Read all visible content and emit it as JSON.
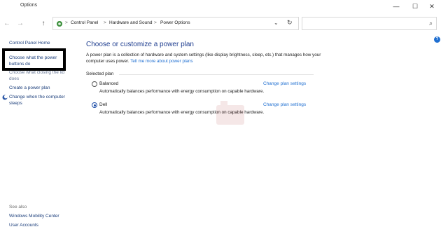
{
  "window": {
    "title": "Options"
  },
  "titlebar": {
    "minimize": "—",
    "maximize": "☐",
    "close": "✕"
  },
  "nav": {
    "back": "←",
    "forward": "→",
    "up": "↑",
    "breadcrumbs": [
      "Control Panel",
      "Hardware and Sound",
      "Power Options"
    ],
    "separator": ">",
    "chevron": "⌄",
    "refresh": "↻",
    "search_icon": "⌕",
    "search_placeholder": ""
  },
  "help": {
    "label": "?"
  },
  "sidebar": {
    "home": "Control Panel Home",
    "items": [
      "Choose what the power buttons do",
      "Choose what closing the lid does",
      "Create a power plan",
      "Change when the computer sleeps"
    ],
    "see_also_title": "See also",
    "see_also": [
      "Windows Mobility Center",
      "User Accounts"
    ]
  },
  "main": {
    "heading": "Choose or customize a power plan",
    "description": "A power plan is a collection of hardware and system settings (like display brightness, sleep, etc.) that manages how your computer uses power.",
    "description_link": "Tell me more about power plans",
    "selected_plan_label": "Selected plan",
    "plans": [
      {
        "name": "Balanced",
        "description": "Automatically balances performance with energy consumption on capable hardware.",
        "link": "Change plan settings",
        "selected": false
      },
      {
        "name": "Dell",
        "description": "Automatically balances performance with energy consumption on capable hardware.",
        "link": "Change plan settings",
        "selected": true
      }
    ]
  },
  "colors": {
    "accent": "#1f6fd1",
    "heading": "#1e3d8f",
    "highlight_box": "#000000"
  }
}
